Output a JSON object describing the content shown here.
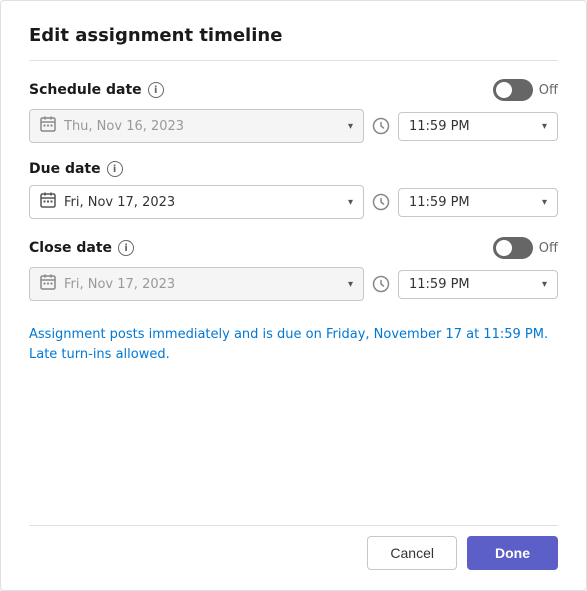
{
  "dialog": {
    "title": "Edit assignment timeline"
  },
  "schedule_date": {
    "label": "Schedule date",
    "toggle_label": "Off",
    "date_value": "Thu, Nov 16, 2023",
    "time_value": "11:59 PM",
    "disabled": true
  },
  "due_date": {
    "label": "Due date",
    "date_value": "Fri, Nov 17, 2023",
    "time_value": "11:59 PM",
    "disabled": false
  },
  "close_date": {
    "label": "Close date",
    "toggle_label": "Off",
    "date_value": "Fri, Nov 17, 2023",
    "time_value": "11:59 PM",
    "disabled": true
  },
  "info_text": "Assignment posts immediately and is due on Friday, November 17 at 11:59 PM. Late turn-ins allowed.",
  "footer": {
    "cancel_label": "Cancel",
    "done_label": "Done"
  }
}
